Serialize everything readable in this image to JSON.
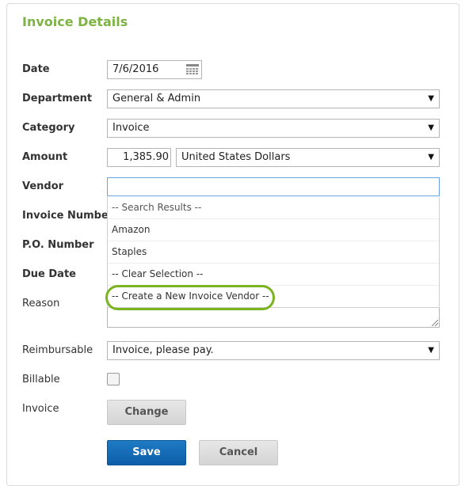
{
  "title": "Invoice Details",
  "colors": {
    "accent_green": "#7cb342",
    "save_blue": "#0d5ea8",
    "ring_green": "#7cb321"
  },
  "fields": {
    "date": {
      "label": "Date",
      "value": "7/6/2016",
      "icon": "calendar-icon"
    },
    "department": {
      "label": "Department",
      "value": "General & Admin"
    },
    "category": {
      "label": "Category",
      "value": "Invoice"
    },
    "amount": {
      "label": "Amount",
      "value": "1,385.90",
      "currency": "United States Dollars"
    },
    "vendor": {
      "label": "Vendor",
      "value": ""
    },
    "invoice_number": {
      "label": "Invoice Number"
    },
    "po_number": {
      "label": "P.O. Number"
    },
    "due_date": {
      "label": "Due Date"
    },
    "reason": {
      "label": "Reason"
    },
    "reimbursable": {
      "label": "Reimbursable",
      "value": "Invoice, please pay."
    },
    "billable": {
      "label": "Billable",
      "checked": false
    },
    "invoice": {
      "label": "Invoice",
      "button": "Change"
    }
  },
  "vendor_dropdown": {
    "items": [
      "-- Search Results --",
      "Amazon",
      "Staples",
      "-- Clear Selection --",
      "-- Create a New Invoice Vendor --"
    ],
    "highlighted": "-- Create a New Invoice Vendor --"
  },
  "actions": {
    "save": "Save",
    "cancel": "Cancel"
  },
  "select_arrow": "▼"
}
